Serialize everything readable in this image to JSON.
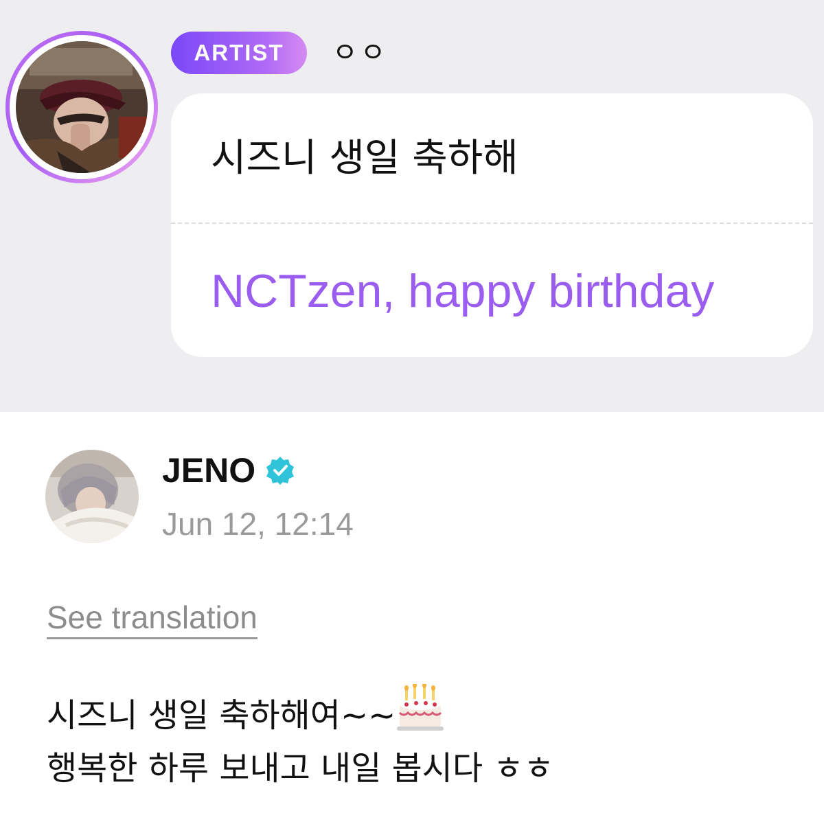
{
  "message": {
    "badge_label": "ARTIST",
    "artist_name": "ㅇㅇ",
    "original_text": "시즈니 생일 축하해",
    "translated_text": "NCTzen, happy birthday"
  },
  "post": {
    "author": "JENO",
    "verified_icon": "verified-badge-icon",
    "timestamp": "Jun 12, 12:14",
    "see_translation_label": "See translation",
    "body_line_1": "시즈니 생일 축하해여~~",
    "body_line_1_emoji": "birthday-cake-icon",
    "body_line_2": "행복한 하루 보내고 내일 봅시다 ㅎㅎ"
  },
  "colors": {
    "panel_bg": "#eeeef0",
    "badge_gradient_start": "#7a48f8",
    "badge_gradient_end": "#d58bf2",
    "translation_text": "#9b5cf0",
    "verified": "#2fc4d9",
    "timestamp": "#9a9a9a"
  }
}
